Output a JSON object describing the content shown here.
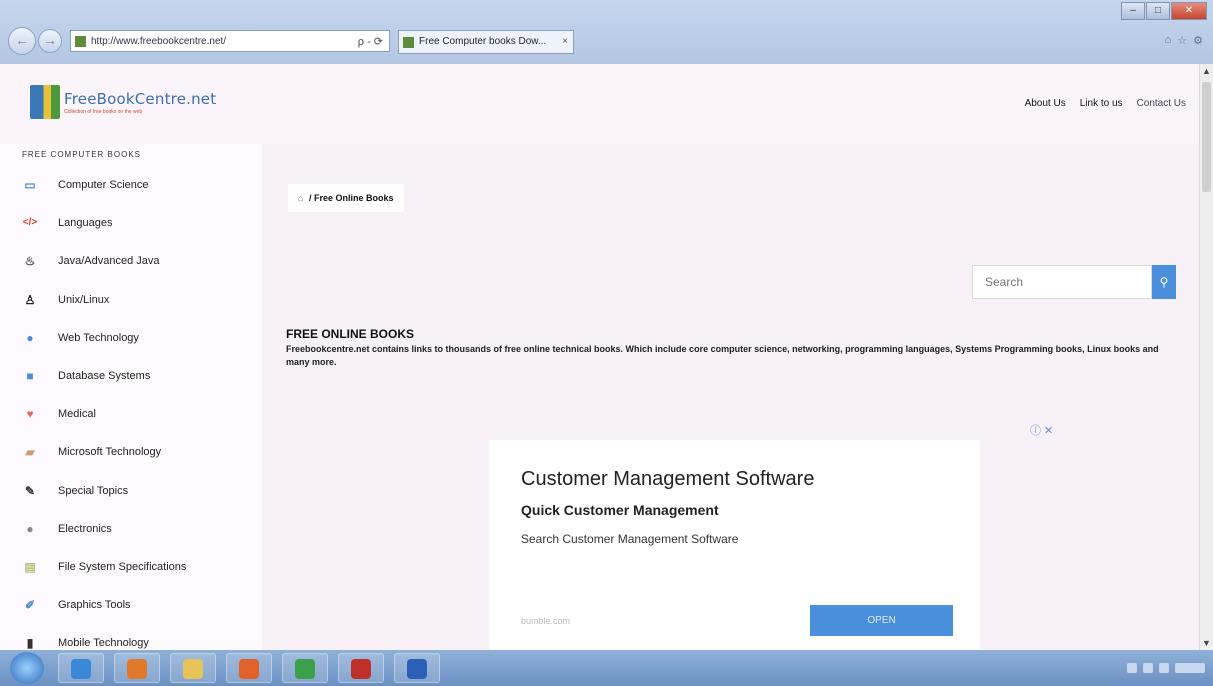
{
  "browser": {
    "url": "http://www.freebookcentre.net/",
    "tab_title": "Free Computer books Dow...",
    "tab_close": "×",
    "nav_back": "←",
    "nav_forward": "→",
    "addr_tools": "ρ - ⟳",
    "toolbar_icons": [
      "⌂",
      "☆",
      "⚙"
    ]
  },
  "header": {
    "logo_name": "FreeBookCentre.net",
    "logo_tagline": "Collection of free books on the web",
    "nav": [
      "About Us",
      "Link to us",
      "Contact Us"
    ]
  },
  "sidebar": {
    "title": "FREE COMPUTER BOOKS",
    "items": [
      {
        "label": "Computer Science",
        "icon": "monitor-icon",
        "color": "#4a8fdb"
      },
      {
        "label": "Languages",
        "icon": "code-icon",
        "color": "#d03a2c"
      },
      {
        "label": "Java/Advanced Java",
        "icon": "coffee-icon",
        "color": "#555555"
      },
      {
        "label": "Unix/Linux",
        "icon": "penguin-icon",
        "color": "#222222"
      },
      {
        "label": "Web Technology",
        "icon": "globe-icon",
        "color": "#4a8fdb"
      },
      {
        "label": "Database Systems",
        "icon": "database-icon",
        "color": "#4a8fdb"
      },
      {
        "label": "Medical",
        "icon": "heart-icon",
        "color": "#e06a6a"
      },
      {
        "label": "Microsoft Technology",
        "icon": "windows-icon",
        "color": "#c9a070"
      },
      {
        "label": "Special Topics",
        "icon": "pen-icon",
        "color": "#333333"
      },
      {
        "label": "Electronics",
        "icon": "chip-icon",
        "color": "#888888"
      },
      {
        "label": "File System Specifications",
        "icon": "file-icon",
        "color": "#b8c070"
      },
      {
        "label": "Graphics Tools",
        "icon": "brush-icon",
        "color": "#4a8fdb"
      },
      {
        "label": "Mobile Technology",
        "icon": "phone-icon",
        "color": "#333333"
      }
    ]
  },
  "breadcrumb": {
    "home_icon": "⌂",
    "sep": "/",
    "label": "Free Online Books"
  },
  "search": {
    "placeholder": "Search",
    "button_icon": "⚲"
  },
  "intro": {
    "heading": "FREE ONLINE BOOKS",
    "text": "Freebookcentre.net contains links to thousands of free online technical books. Which include core computer science, networking, programming languages, Systems Programming books, Linux books and many more."
  },
  "ad": {
    "corner": "ⓘ ✕",
    "headline": "Customer Management Software",
    "subheadline": "Quick Customer Management",
    "description": "Search Customer Management Software",
    "domain": "bumble.com",
    "button": "OPEN"
  },
  "taskbar": {
    "apps": [
      {
        "name": "ie-icon",
        "color": "#3b87d8"
      },
      {
        "name": "media-icon",
        "color": "#e07a2a"
      },
      {
        "name": "folder-icon",
        "color": "#e8c35a"
      },
      {
        "name": "firefox-icon",
        "color": "#e0622a"
      },
      {
        "name": "chrome-icon",
        "color": "#3aa04a"
      },
      {
        "name": "acrobat-icon",
        "color": "#c0302a"
      },
      {
        "name": "word-icon",
        "color": "#2b5fb8"
      }
    ]
  }
}
